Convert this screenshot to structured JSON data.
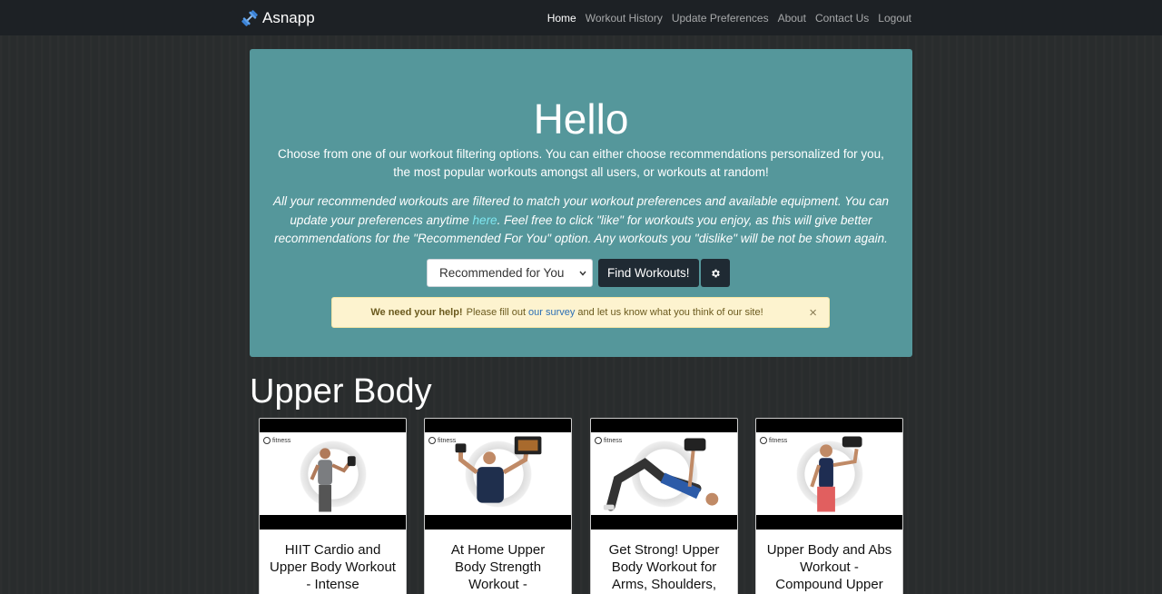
{
  "navbar": {
    "brand": "Asnapp",
    "links": [
      {
        "label": "Home",
        "active": true
      },
      {
        "label": "Workout History",
        "active": false
      },
      {
        "label": "Update Preferences",
        "active": false
      },
      {
        "label": "About",
        "active": false
      },
      {
        "label": "Contact Us",
        "active": false
      },
      {
        "label": "Logout",
        "active": false
      }
    ]
  },
  "hero": {
    "title": "Hello",
    "lead": "Choose from one of our workout filtering options. You can either choose recommendations personalized for you, the most popular workouts amongst all users, or workouts at random!",
    "note_before_link": "All your recommended workouts are filtered to match your workout preferences and available equipment. You can update your preferences anytime ",
    "note_link": "here",
    "note_after_link": ". Feel free to click \"like\" for workouts you enjoy, as this will give better recommendations for the \"Recommended For You\" option. Any workouts you \"dislike\" will be not be shown again.",
    "filter_select": "Recommended for You",
    "find_button": "Find Workouts!",
    "settings_icon": "gear-icon"
  },
  "alert": {
    "strong": "We need your help!",
    "before_link": "Please fill out",
    "link": "our survey",
    "after_link": "and let us know what you think of our site!",
    "close": "×"
  },
  "section": {
    "title": "Upper Body",
    "cards": [
      {
        "title": "HIIT Cardio and Upper Body Workout - Intense",
        "logo": "fitness"
      },
      {
        "title": "At Home Upper Body Strength Workout -",
        "logo": "fitness"
      },
      {
        "title": "Get Strong! Upper Body Workout for Arms, Shoulders,",
        "logo": "fitness"
      },
      {
        "title": "Upper Body and Abs Workout - Compound Upper",
        "logo": "fitness"
      }
    ]
  },
  "colors": {
    "navbar": "#1d2125",
    "hero": "#55979b",
    "page_bg": "#2a2d2e",
    "alert_bg": "#fdf3cf",
    "link_blue": "#2c6fb5"
  }
}
